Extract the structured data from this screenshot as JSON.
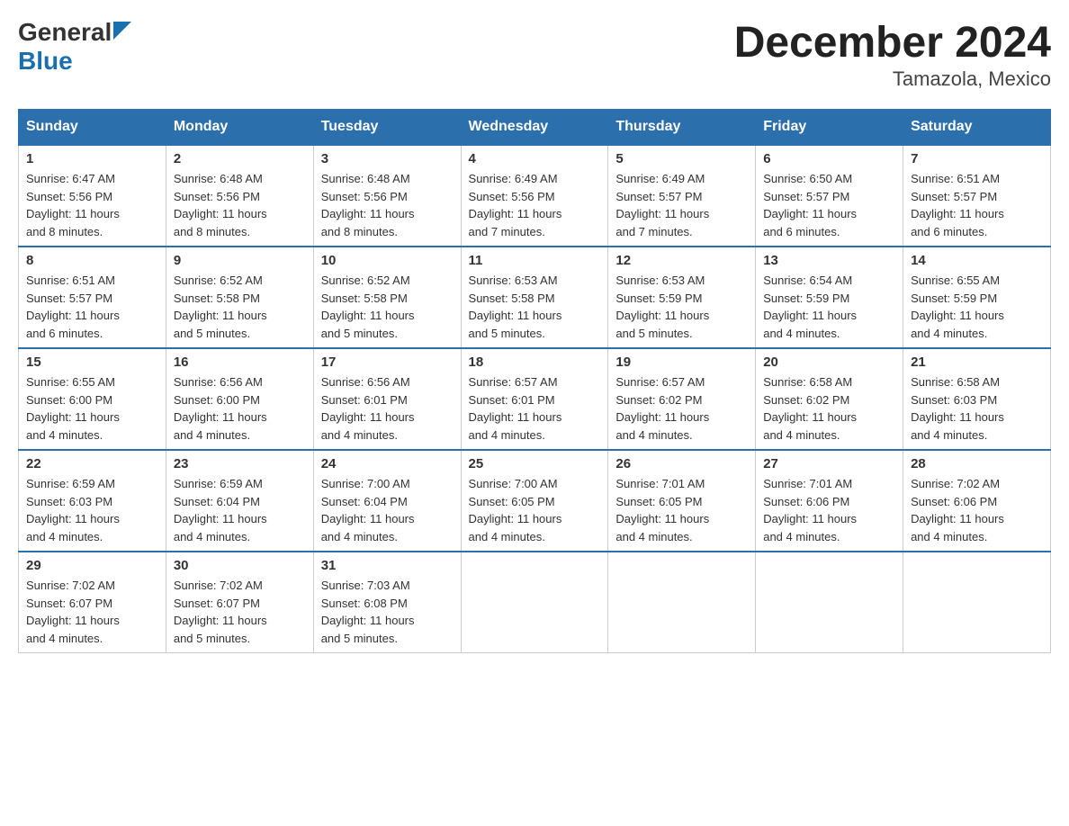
{
  "header": {
    "logo_general": "General",
    "logo_blue": "Blue",
    "month_title": "December 2024",
    "subtitle": "Tamazola, Mexico"
  },
  "days_of_week": [
    "Sunday",
    "Monday",
    "Tuesday",
    "Wednesday",
    "Thursday",
    "Friday",
    "Saturday"
  ],
  "weeks": [
    [
      {
        "day": "1",
        "sunrise": "6:47 AM",
        "sunset": "5:56 PM",
        "daylight": "11 hours and 8 minutes."
      },
      {
        "day": "2",
        "sunrise": "6:48 AM",
        "sunset": "5:56 PM",
        "daylight": "11 hours and 8 minutes."
      },
      {
        "day": "3",
        "sunrise": "6:48 AM",
        "sunset": "5:56 PM",
        "daylight": "11 hours and 8 minutes."
      },
      {
        "day": "4",
        "sunrise": "6:49 AM",
        "sunset": "5:56 PM",
        "daylight": "11 hours and 7 minutes."
      },
      {
        "day": "5",
        "sunrise": "6:49 AM",
        "sunset": "5:57 PM",
        "daylight": "11 hours and 7 minutes."
      },
      {
        "day": "6",
        "sunrise": "6:50 AM",
        "sunset": "5:57 PM",
        "daylight": "11 hours and 6 minutes."
      },
      {
        "day": "7",
        "sunrise": "6:51 AM",
        "sunset": "5:57 PM",
        "daylight": "11 hours and 6 minutes."
      }
    ],
    [
      {
        "day": "8",
        "sunrise": "6:51 AM",
        "sunset": "5:57 PM",
        "daylight": "11 hours and 6 minutes."
      },
      {
        "day": "9",
        "sunrise": "6:52 AM",
        "sunset": "5:58 PM",
        "daylight": "11 hours and 5 minutes."
      },
      {
        "day": "10",
        "sunrise": "6:52 AM",
        "sunset": "5:58 PM",
        "daylight": "11 hours and 5 minutes."
      },
      {
        "day": "11",
        "sunrise": "6:53 AM",
        "sunset": "5:58 PM",
        "daylight": "11 hours and 5 minutes."
      },
      {
        "day": "12",
        "sunrise": "6:53 AM",
        "sunset": "5:59 PM",
        "daylight": "11 hours and 5 minutes."
      },
      {
        "day": "13",
        "sunrise": "6:54 AM",
        "sunset": "5:59 PM",
        "daylight": "11 hours and 4 minutes."
      },
      {
        "day": "14",
        "sunrise": "6:55 AM",
        "sunset": "5:59 PM",
        "daylight": "11 hours and 4 minutes."
      }
    ],
    [
      {
        "day": "15",
        "sunrise": "6:55 AM",
        "sunset": "6:00 PM",
        "daylight": "11 hours and 4 minutes."
      },
      {
        "day": "16",
        "sunrise": "6:56 AM",
        "sunset": "6:00 PM",
        "daylight": "11 hours and 4 minutes."
      },
      {
        "day": "17",
        "sunrise": "6:56 AM",
        "sunset": "6:01 PM",
        "daylight": "11 hours and 4 minutes."
      },
      {
        "day": "18",
        "sunrise": "6:57 AM",
        "sunset": "6:01 PM",
        "daylight": "11 hours and 4 minutes."
      },
      {
        "day": "19",
        "sunrise": "6:57 AM",
        "sunset": "6:02 PM",
        "daylight": "11 hours and 4 minutes."
      },
      {
        "day": "20",
        "sunrise": "6:58 AM",
        "sunset": "6:02 PM",
        "daylight": "11 hours and 4 minutes."
      },
      {
        "day": "21",
        "sunrise": "6:58 AM",
        "sunset": "6:03 PM",
        "daylight": "11 hours and 4 minutes."
      }
    ],
    [
      {
        "day": "22",
        "sunrise": "6:59 AM",
        "sunset": "6:03 PM",
        "daylight": "11 hours and 4 minutes."
      },
      {
        "day": "23",
        "sunrise": "6:59 AM",
        "sunset": "6:04 PM",
        "daylight": "11 hours and 4 minutes."
      },
      {
        "day": "24",
        "sunrise": "7:00 AM",
        "sunset": "6:04 PM",
        "daylight": "11 hours and 4 minutes."
      },
      {
        "day": "25",
        "sunrise": "7:00 AM",
        "sunset": "6:05 PM",
        "daylight": "11 hours and 4 minutes."
      },
      {
        "day": "26",
        "sunrise": "7:01 AM",
        "sunset": "6:05 PM",
        "daylight": "11 hours and 4 minutes."
      },
      {
        "day": "27",
        "sunrise": "7:01 AM",
        "sunset": "6:06 PM",
        "daylight": "11 hours and 4 minutes."
      },
      {
        "day": "28",
        "sunrise": "7:02 AM",
        "sunset": "6:06 PM",
        "daylight": "11 hours and 4 minutes."
      }
    ],
    [
      {
        "day": "29",
        "sunrise": "7:02 AM",
        "sunset": "6:07 PM",
        "daylight": "11 hours and 4 minutes."
      },
      {
        "day": "30",
        "sunrise": "7:02 AM",
        "sunset": "6:07 PM",
        "daylight": "11 hours and 5 minutes."
      },
      {
        "day": "31",
        "sunrise": "7:03 AM",
        "sunset": "6:08 PM",
        "daylight": "11 hours and 5 minutes."
      },
      null,
      null,
      null,
      null
    ]
  ],
  "labels": {
    "sunrise": "Sunrise:",
    "sunset": "Sunset:",
    "daylight": "Daylight:"
  }
}
